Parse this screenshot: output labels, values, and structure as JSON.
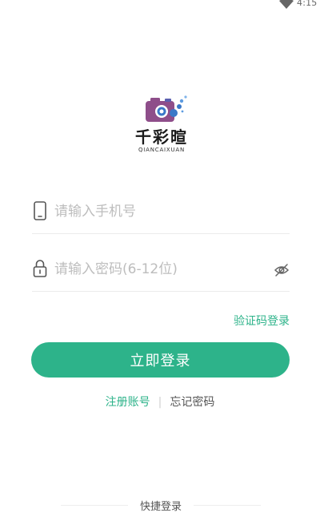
{
  "status_bar": {
    "time": "4:15"
  },
  "logo": {
    "title": "千彩暄",
    "subtitle": "QIANCAIXUAN"
  },
  "form": {
    "phone_placeholder": "请输入手机号",
    "phone_value": "",
    "password_placeholder": "请输入密码(6-12位)",
    "password_value": "",
    "code_login_label": "验证码登录",
    "login_button_label": "立即登录"
  },
  "links": {
    "register_label": "注册账号",
    "separator": "|",
    "forgot_label": "忘记密码"
  },
  "quick_login": {
    "label": "快捷登录"
  },
  "colors": {
    "accent": "#2db38a",
    "placeholder": "#bdbdbd",
    "logo_purple": "#8e4e8a",
    "logo_blue": "#3a78c8"
  }
}
